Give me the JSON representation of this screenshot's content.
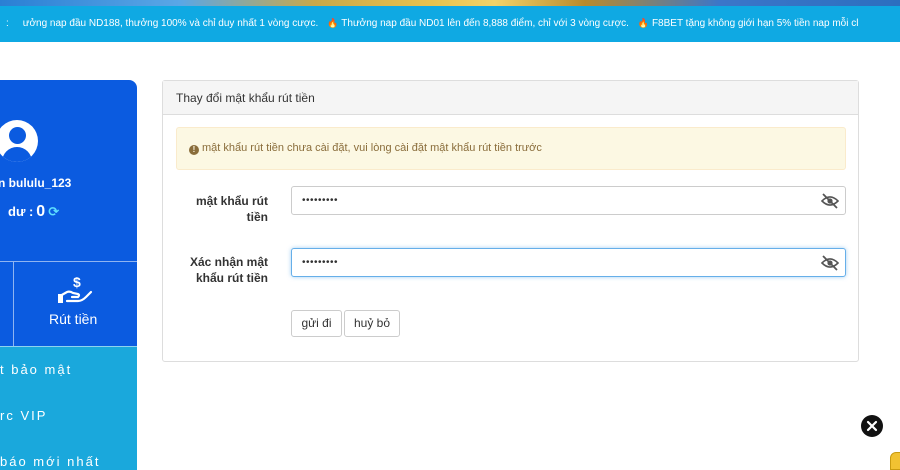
{
  "marquee": {
    "lead": ":",
    "messages": [
      "ưởng nap đầu ND188, thưởng 100% và chỉ duy nhất 1 vòng cược.",
      "Thưởng nap đầu ND01 lên đến 8,888 điểm, chỉ với 3 vòng cược.",
      "F8BET tặng không giới hạn 5% tiền nap mỗi cl"
    ],
    "icon": "fire-icon"
  },
  "sidebar": {
    "username": "n bululu_123",
    "balance_label": "dư :",
    "balance_value": "0",
    "withdraw_label": "Rút tiền",
    "menu": [
      "t bảo mật",
      "rc VIP",
      "báo mới nhất"
    ]
  },
  "panel": {
    "title": "Thay đổi mật khẩu rút tiền",
    "alert": "mật khẩu rút tiền chưa cài đặt, vui lòng cài đặt mật khẩu rút tiền trước",
    "field1": {
      "label_line1": "mật khẩu rút",
      "label_line2": "tiền",
      "value": "•••••••••"
    },
    "field2": {
      "label_line1": "Xác nhận mật",
      "label_line2": "khẩu rút tiền",
      "value": "•••••••••"
    },
    "submit_label": "gửi đi",
    "cancel_label": "huỷ bỏ"
  },
  "colors": {
    "marquee_bg": "#0fa9e3",
    "sidebar_bg": "#0b5be0",
    "menu_bg": "#1aa8dc",
    "alert_bg": "#fcf8e3",
    "alert_text": "#8a6d3b"
  }
}
